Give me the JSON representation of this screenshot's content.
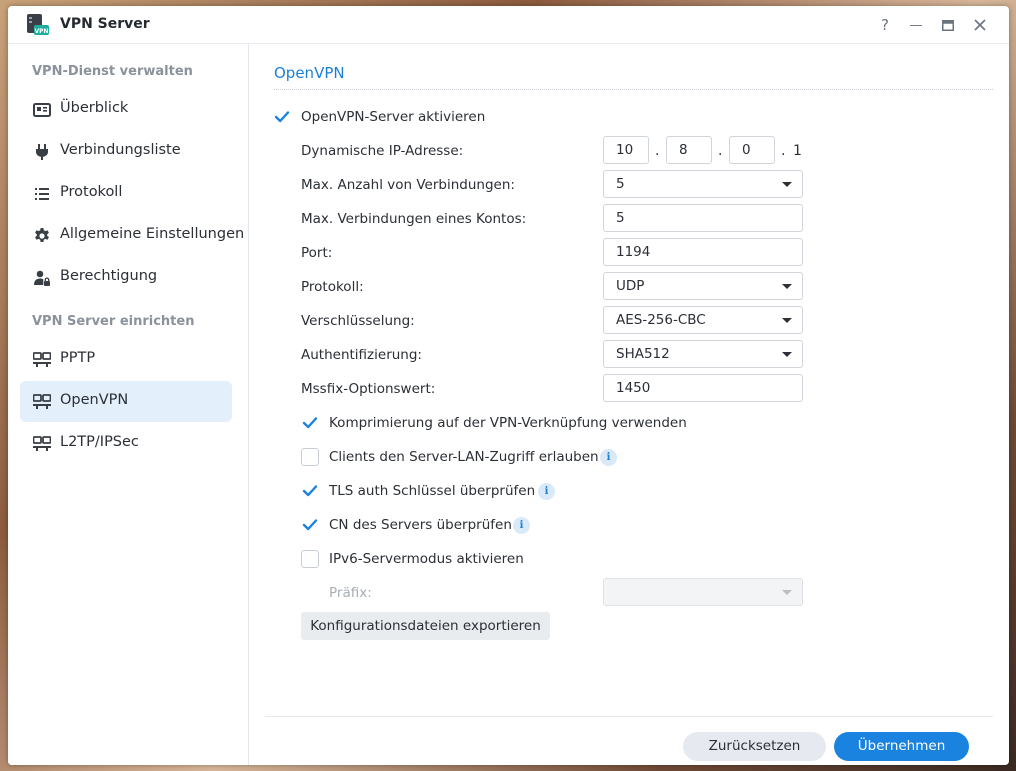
{
  "window": {
    "title": "VPN Server",
    "app_icon_text": "VPN",
    "controls": {
      "help": "?",
      "minimize": "—",
      "maximize": "▭",
      "close": "✕"
    }
  },
  "sidebar": {
    "section1": "VPN-Dienst verwalten",
    "manage_items": [
      {
        "label": "Überblick",
        "icon": "overview-card-icon"
      },
      {
        "label": "Verbindungsliste",
        "icon": "plug-icon"
      },
      {
        "label": "Protokoll",
        "icon": "list-icon"
      },
      {
        "label": "Allgemeine Einstellungen",
        "icon": "gear-icon"
      },
      {
        "label": "Berechtigung",
        "icon": "user-lock-icon"
      }
    ],
    "section2": "VPN Server einrichten",
    "setup_items": [
      {
        "label": "PPTP",
        "icon": "network-icon",
        "active": false
      },
      {
        "label": "OpenVPN",
        "icon": "network-icon",
        "active": true
      },
      {
        "label": "L2TP/IPSec",
        "icon": "network-icon",
        "active": false
      }
    ]
  },
  "main": {
    "section_title": "OpenVPN",
    "enable_label": "OpenVPN-Server aktivieren",
    "enable_checked": true,
    "dynamic_ip": {
      "label": "Dynamische IP-Adresse:",
      "octets": [
        "10",
        "8",
        "0"
      ],
      "last": "1",
      "dot": "."
    },
    "max_connections": {
      "label": "Max. Anzahl von Verbindungen:",
      "value": "5"
    },
    "max_per_account": {
      "label": "Max. Verbindungen eines Kontos:",
      "value": "5"
    },
    "port": {
      "label": "Port:",
      "value": "1194"
    },
    "protocol": {
      "label": "Protokoll:",
      "value": "UDP"
    },
    "encryption": {
      "label": "Verschlüsselung:",
      "value": "AES-256-CBC"
    },
    "auth": {
      "label": "Authentifizierung:",
      "value": "SHA512"
    },
    "mssfix": {
      "label": "Mssfix-Optionswert:",
      "value": "1450"
    },
    "checks": [
      {
        "label": "Komprimierung auf der VPN-Verknüpfung verwenden",
        "checked": true,
        "info": false
      },
      {
        "label": "Clients den Server-LAN-Zugriff erlauben",
        "checked": false,
        "info": true
      },
      {
        "label": "TLS auth Schlüssel überprüfen",
        "checked": true,
        "info": true
      },
      {
        "label": "CN des Servers überprüfen",
        "checked": true,
        "info": true
      },
      {
        "label": "IPv6-Servermodus aktivieren",
        "checked": false,
        "info": false
      }
    ],
    "info_glyph": "i",
    "prefix": {
      "label": "Präfix:",
      "value": ""
    },
    "export_button": "Konfigurationsdateien exportieren"
  },
  "footer": {
    "reset": "Zurücksetzen",
    "apply": "Übernehmen"
  },
  "colors": {
    "accent": "#1a82df",
    "title_blue": "#1b7fd6",
    "active_bg": "#e3effb",
    "check_blue": "#1a82df"
  }
}
